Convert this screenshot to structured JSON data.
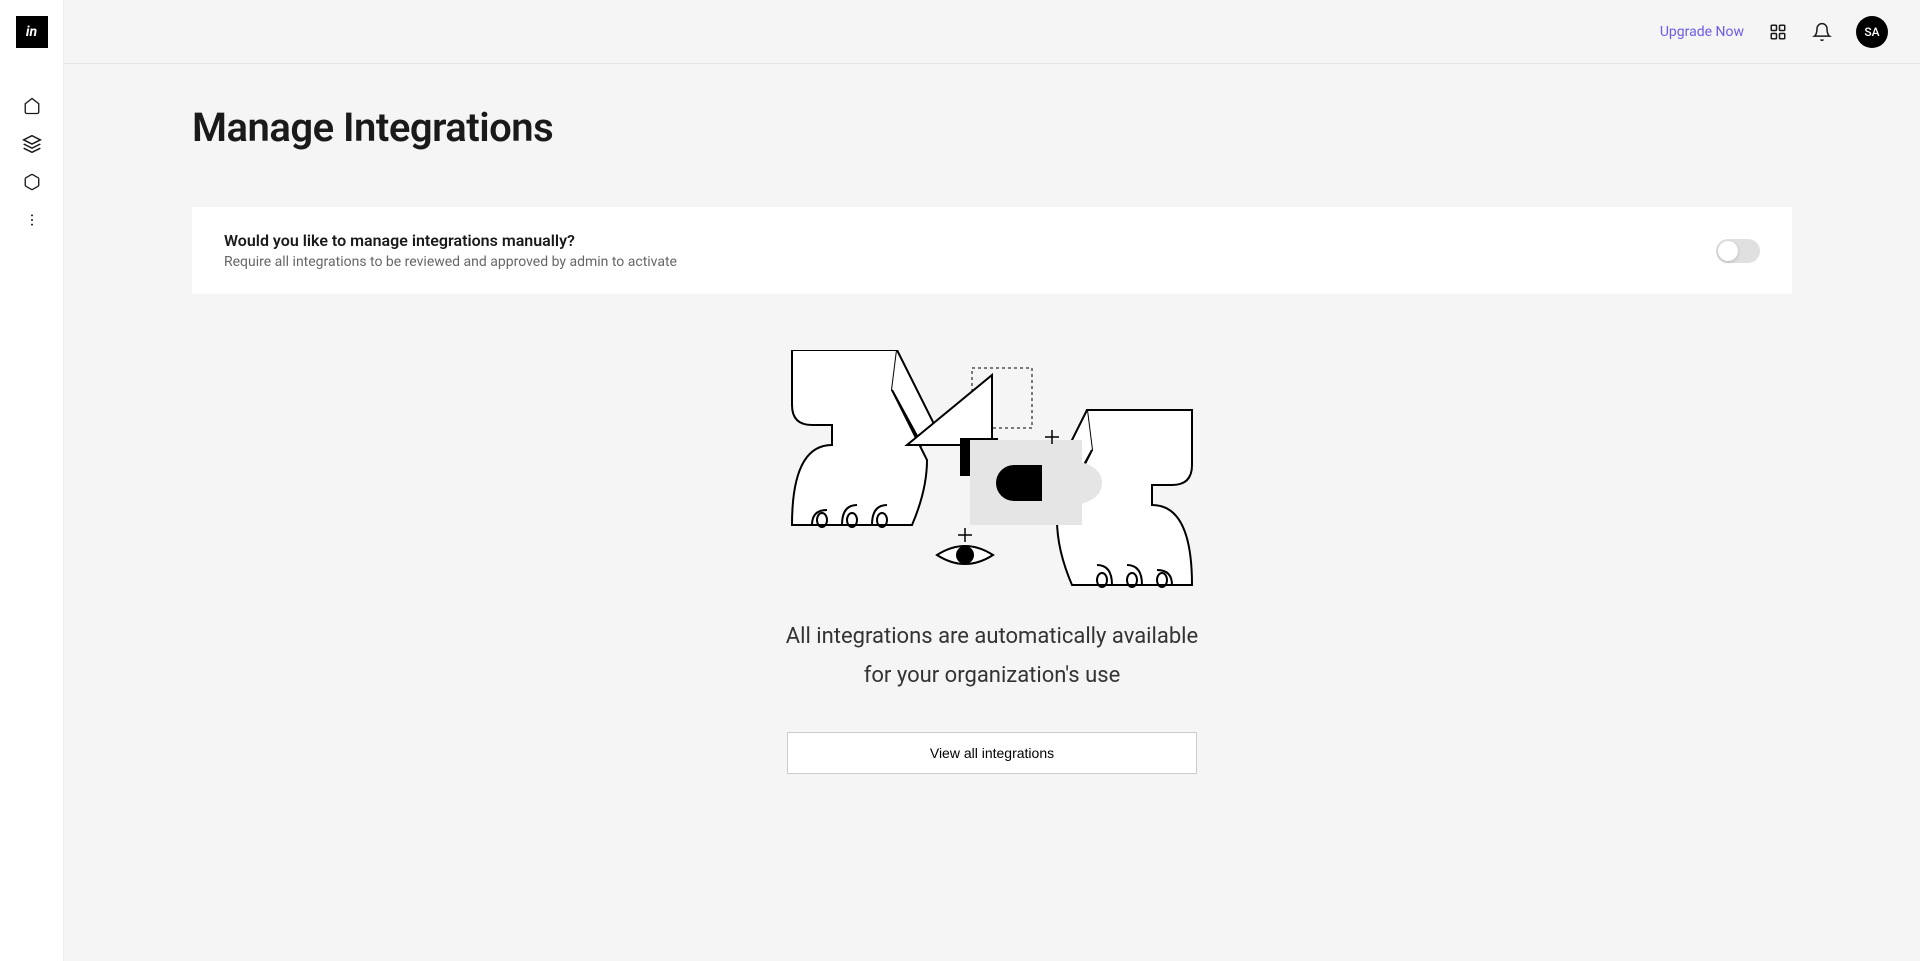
{
  "logo": "in",
  "topbar": {
    "upgrade": "Upgrade Now",
    "avatar": "SA"
  },
  "page": {
    "title": "Manage Integrations"
  },
  "card": {
    "heading": "Would you like to manage integrations manually?",
    "subtext": "Require all integrations to be reviewed and approved by admin to activate"
  },
  "empty": {
    "line1": "All integrations are automatically available",
    "line2": "for your organization's use",
    "button": "View all integrations"
  }
}
